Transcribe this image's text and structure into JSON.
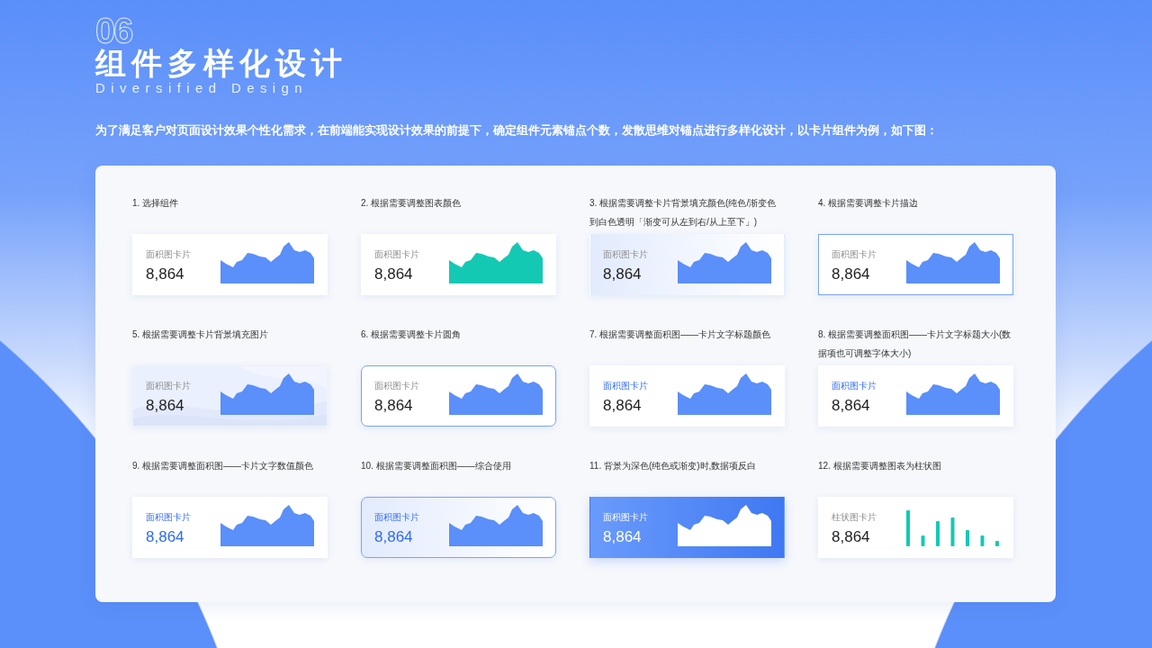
{
  "header": {
    "number": "06",
    "title": "组件多样化设计",
    "subtitle": "Diversified Design"
  },
  "intro": "为了满足客户对页面设计效果个性化需求，在前端能实现设计效果的前提下，确定组件元素锚点个数，发散思维对锚点进行多样化设计，以卡片组件为例，如下图：",
  "cards": [
    {
      "caption": "1. 选择组件",
      "title": "面积图卡片",
      "value": "8,864",
      "kind": "plain",
      "outlined": false,
      "rounded": false,
      "title_highlighted": false,
      "value_highlighted": false,
      "chart": {
        "kind": "area",
        "color": "#5b8ff9"
      }
    },
    {
      "caption": "2. 根据需要调整图表颜色",
      "title": "面积图卡片",
      "value": "8,864",
      "kind": "plain",
      "outlined": false,
      "rounded": false,
      "title_highlighted": false,
      "value_highlighted": false,
      "chart": {
        "kind": "area",
        "color": "#14c9b4"
      }
    },
    {
      "caption": "3. 根据需要调整卡片背景填充颜色(纯色/渐变色到白色透明「渐变可从左到右/从上至下」)",
      "title": "面积图卡片",
      "value": "8,864",
      "kind": "gradient",
      "outlined": false,
      "rounded": false,
      "title_highlighted": false,
      "value_highlighted": false,
      "chart": {
        "kind": "area",
        "color": "#5b8ff9"
      }
    },
    {
      "caption": "4. 根据需要调整卡片描边",
      "title": "面积图卡片",
      "value": "8,864",
      "kind": "plain",
      "outlined": true,
      "rounded": false,
      "title_highlighted": false,
      "value_highlighted": false,
      "chart": {
        "kind": "area",
        "color": "#5b8ff9"
      }
    },
    {
      "caption": "5. 根据需要调整卡片背景填充图片",
      "title": "面积图卡片",
      "value": "8,864",
      "kind": "picture",
      "outlined": false,
      "rounded": false,
      "title_highlighted": false,
      "value_highlighted": false,
      "chart": {
        "kind": "area",
        "color": "#5b8ff9"
      }
    },
    {
      "caption": "6. 根据需要调整卡片圆角",
      "title": "面积图卡片",
      "value": "8,864",
      "kind": "plain",
      "outlined": true,
      "rounded": true,
      "title_highlighted": false,
      "value_highlighted": false,
      "chart": {
        "kind": "area",
        "color": "#5b8ff9"
      }
    },
    {
      "caption": "7. 根据需要调整面积图——卡片文字标题颜色",
      "title": "面积图卡片",
      "value": "8,864",
      "kind": "plain",
      "outlined": false,
      "rounded": false,
      "title_highlighted": true,
      "value_highlighted": false,
      "chart": {
        "kind": "area",
        "color": "#5b8ff9"
      }
    },
    {
      "caption": "8. 根据需要调整面积图——卡片文字标题大小(数据项也可调整字体大小)",
      "title": "面积图卡片",
      "value": "8,864",
      "kind": "plain",
      "outlined": false,
      "rounded": false,
      "title_highlighted": true,
      "value_highlighted": false,
      "chart": {
        "kind": "area",
        "color": "#5b8ff9"
      }
    },
    {
      "caption": "9. 根据需要调整面积图——卡片文字数值颜色",
      "title": "面积图卡片",
      "value": "8,864",
      "kind": "plain",
      "outlined": false,
      "rounded": false,
      "title_highlighted": true,
      "value_highlighted": true,
      "chart": {
        "kind": "area",
        "color": "#5b8ff9"
      }
    },
    {
      "caption": "10. 根据需要调整面积图——综合使用",
      "title": "面积图卡片",
      "value": "8,864",
      "kind": "gradient",
      "outlined": true,
      "rounded": true,
      "title_highlighted": true,
      "value_highlighted": true,
      "chart": {
        "kind": "area",
        "color": "#5b8ff9"
      }
    },
    {
      "caption": "11. 背景为深色(纯色或渐变)时,数据项反白",
      "title": "面积图卡片",
      "value": "8,864",
      "kind": "dark",
      "outlined": false,
      "rounded": false,
      "chart": {
        "kind": "area",
        "color": "#ffffff"
      }
    },
    {
      "caption": "12. 根据需要调整图表为柱状图",
      "title": "柱状图卡片",
      "value": "8,864",
      "kind": "plain",
      "outlined": false,
      "rounded": false,
      "title_highlighted": false,
      "value_highlighted": false,
      "chart": {
        "kind": "bar",
        "color": "#14c9b4"
      }
    }
  ]
}
